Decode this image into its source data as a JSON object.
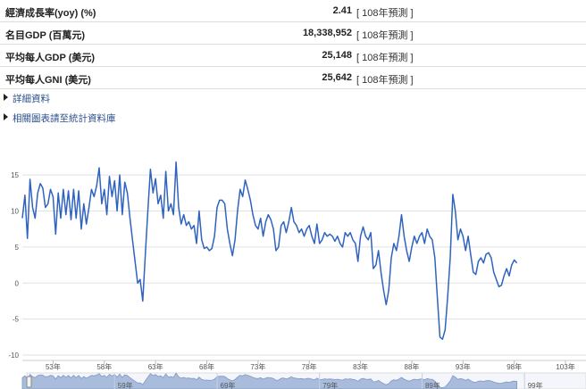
{
  "stats": [
    {
      "label": "經濟成長率(yoy) (%)",
      "value": "2.41",
      "note": "[ 108年預測 ]"
    },
    {
      "label": "名目GDP (百萬元)",
      "value": "18,338,952",
      "note": "[ 108年預測 ]"
    },
    {
      "label": "平均每人GDP (美元)",
      "value": "25,148",
      "note": "[ 108年預測 ]"
    },
    {
      "label": "平均每人GNI (美元)",
      "value": "25,642",
      "note": "[ 108年預測 ]"
    }
  ],
  "links": [
    {
      "label": "詳細資料"
    },
    {
      "label": "相關圖表請至統計資料庫"
    }
  ],
  "colors": {
    "line": "#2f63c0",
    "grid": "#e0e0e0",
    "navigator_fill": "#a9bcdc",
    "link": "#2b4f8c"
  },
  "chart_data": {
    "type": "line",
    "ylim": [
      -10,
      17
    ],
    "y_ticks": [
      -10,
      -5,
      0,
      5,
      10,
      15
    ],
    "x_ticks": [
      "53年",
      "58年",
      "63年",
      "68年",
      "73年",
      "78年",
      "83年",
      "88年",
      "93年",
      "98年",
      "103年"
    ],
    "x_tick_values": [
      53,
      58,
      63,
      68,
      73,
      78,
      83,
      88,
      93,
      98,
      103
    ],
    "navigator_ticks": [
      "59年",
      "69年",
      "79年",
      "89年",
      "99年"
    ],
    "navigator_tick_values": [
      59,
      69,
      79,
      89,
      99
    ],
    "grid": true,
    "series": [
      {
        "values": [
          [
            50.0,
            9.0
          ],
          [
            50.25,
            12.2
          ],
          [
            50.5,
            6.2
          ],
          [
            50.75,
            14.4
          ],
          [
            51.0,
            10.5
          ],
          [
            51.25,
            9.0
          ],
          [
            51.5,
            12.5
          ],
          [
            51.75,
            13.8
          ],
          [
            52.0,
            13.2
          ],
          [
            52.25,
            10.5
          ],
          [
            52.5,
            11.0
          ],
          [
            52.75,
            13.0
          ],
          [
            53.0,
            12.0
          ],
          [
            53.25,
            6.8
          ],
          [
            53.5,
            12.5
          ],
          [
            53.75,
            9.0
          ],
          [
            54.0,
            13.0
          ],
          [
            54.25,
            9.5
          ],
          [
            54.5,
            12.8
          ],
          [
            54.75,
            8.8
          ],
          [
            55.0,
            13.0
          ],
          [
            55.25,
            9.0
          ],
          [
            55.5,
            12.8
          ],
          [
            55.75,
            7.5
          ],
          [
            56.0,
            11.0
          ],
          [
            56.25,
            8.2
          ],
          [
            56.5,
            10.5
          ],
          [
            56.75,
            13.0
          ],
          [
            57.0,
            12.0
          ],
          [
            57.25,
            13.5
          ],
          [
            57.5,
            16.0
          ],
          [
            57.75,
            11.0
          ],
          [
            58.0,
            13.0
          ],
          [
            58.25,
            9.5
          ],
          [
            58.5,
            14.8
          ],
          [
            58.75,
            12.0
          ],
          [
            59.0,
            14.2
          ],
          [
            59.25,
            10.0
          ],
          [
            59.5,
            15.0
          ],
          [
            59.75,
            9.5
          ],
          [
            60.0,
            14.0
          ],
          [
            60.25,
            12.5
          ],
          [
            60.5,
            9.0
          ],
          [
            60.75,
            6.0
          ],
          [
            61.0,
            3.0
          ],
          [
            61.25,
            0.0
          ],
          [
            61.5,
            0.5
          ],
          [
            61.75,
            -2.5
          ],
          [
            62.0,
            4.0
          ],
          [
            62.25,
            10.0
          ],
          [
            62.5,
            15.8
          ],
          [
            62.75,
            12.5
          ],
          [
            63.0,
            14.5
          ],
          [
            63.25,
            11.0
          ],
          [
            63.5,
            12.2
          ],
          [
            63.75,
            9.0
          ],
          [
            64.0,
            15.5
          ],
          [
            64.25,
            10.0
          ],
          [
            64.5,
            11.0
          ],
          [
            64.75,
            9.5
          ],
          [
            65.0,
            16.8
          ],
          [
            65.25,
            10.5
          ],
          [
            65.5,
            8.2
          ],
          [
            65.75,
            9.5
          ],
          [
            66.0,
            8.0
          ],
          [
            66.25,
            8.5
          ],
          [
            66.5,
            7.5
          ],
          [
            66.75,
            8.0
          ],
          [
            67.0,
            5.5
          ],
          [
            67.25,
            10.0
          ],
          [
            67.5,
            6.0
          ],
          [
            67.75,
            4.8
          ],
          [
            68.0,
            5.0
          ],
          [
            68.25,
            4.5
          ],
          [
            68.5,
            4.8
          ],
          [
            68.75,
            6.5
          ],
          [
            69.0,
            10.5
          ],
          [
            69.25,
            11.5
          ],
          [
            69.5,
            11.5
          ],
          [
            69.75,
            11.0
          ],
          [
            70.0,
            7.5
          ],
          [
            70.25,
            5.5
          ],
          [
            70.5,
            3.8
          ],
          [
            70.75,
            6.0
          ],
          [
            71.0,
            10.0
          ],
          [
            71.25,
            13.0
          ],
          [
            71.5,
            12.0
          ],
          [
            71.75,
            14.3
          ],
          [
            72.0,
            13.0
          ],
          [
            72.25,
            11.5
          ],
          [
            72.5,
            9.5
          ],
          [
            72.75,
            8.0
          ],
          [
            73.0,
            7.5
          ],
          [
            73.25,
            9.0
          ],
          [
            73.5,
            6.5
          ],
          [
            73.75,
            8.5
          ],
          [
            74.0,
            9.5
          ],
          [
            74.25,
            8.8
          ],
          [
            74.5,
            7.5
          ],
          [
            74.75,
            4.5
          ],
          [
            75.0,
            5.0
          ],
          [
            75.25,
            8.0
          ],
          [
            75.5,
            8.5
          ],
          [
            75.75,
            7.0
          ],
          [
            76.0,
            8.5
          ],
          [
            76.25,
            10.5
          ],
          [
            76.5,
            8.5
          ],
          [
            76.75,
            8.0
          ],
          [
            77.0,
            7.0
          ],
          [
            77.25,
            7.5
          ],
          [
            77.5,
            6.5
          ],
          [
            77.75,
            7.5
          ],
          [
            78.0,
            8.0
          ],
          [
            78.25,
            6.5
          ],
          [
            78.5,
            5.5
          ],
          [
            78.75,
            8.2
          ],
          [
            79.0,
            5.5
          ],
          [
            79.25,
            6.0
          ],
          [
            79.5,
            7.0
          ],
          [
            79.75,
            6.5
          ],
          [
            80.0,
            6.8
          ],
          [
            80.25,
            6.5
          ],
          [
            80.5,
            5.8
          ],
          [
            80.75,
            6.5
          ],
          [
            81.0,
            5.5
          ],
          [
            81.25,
            5.0
          ],
          [
            81.5,
            7.0
          ],
          [
            81.75,
            6.5
          ],
          [
            82.0,
            7.0
          ],
          [
            82.25,
            6.0
          ],
          [
            82.5,
            5.5
          ],
          [
            82.75,
            3.0
          ],
          [
            83.0,
            6.5
          ],
          [
            83.25,
            7.8
          ],
          [
            83.5,
            6.5
          ],
          [
            83.75,
            6.0
          ],
          [
            84.0,
            7.0
          ],
          [
            84.25,
            2.0
          ],
          [
            84.5,
            2.5
          ],
          [
            84.75,
            4.5
          ],
          [
            85.0,
            1.5
          ],
          [
            85.25,
            -1.0
          ],
          [
            85.5,
            -3.0
          ],
          [
            85.75,
            -1.0
          ],
          [
            86.0,
            3.5
          ],
          [
            86.25,
            5.5
          ],
          [
            86.5,
            4.5
          ],
          [
            86.75,
            6.5
          ],
          [
            87.0,
            9.5
          ],
          [
            87.25,
            6.5
          ],
          [
            87.5,
            4.5
          ],
          [
            87.75,
            3.0
          ],
          [
            88.0,
            5.0
          ],
          [
            88.25,
            6.5
          ],
          [
            88.5,
            5.5
          ],
          [
            88.75,
            6.5
          ],
          [
            89.0,
            7.0
          ],
          [
            89.25,
            5.5
          ],
          [
            89.5,
            7.5
          ],
          [
            89.75,
            6.5
          ],
          [
            90.0,
            6.0
          ],
          [
            90.25,
            3.5
          ],
          [
            90.5,
            -2.0
          ],
          [
            90.75,
            -7.5
          ],
          [
            91.0,
            -7.8
          ],
          [
            91.25,
            -6.5
          ],
          [
            91.5,
            -2.0
          ],
          [
            91.75,
            3.5
          ],
          [
            92.0,
            12.3
          ],
          [
            92.25,
            10.0
          ],
          [
            92.5,
            6.0
          ],
          [
            92.75,
            7.5
          ],
          [
            93.0,
            6.5
          ],
          [
            93.25,
            4.5
          ],
          [
            93.5,
            6.5
          ],
          [
            93.75,
            4.0
          ],
          [
            94.0,
            1.5
          ],
          [
            94.25,
            1.2
          ],
          [
            94.5,
            3.0
          ],
          [
            94.75,
            3.5
          ],
          [
            95.0,
            2.8
          ],
          [
            95.25,
            4.0
          ],
          [
            95.5,
            4.2
          ],
          [
            95.75,
            3.5
          ],
          [
            96.0,
            1.5
          ],
          [
            96.25,
            0.5
          ],
          [
            96.5,
            -0.5
          ],
          [
            96.75,
            -0.3
          ],
          [
            97.0,
            1.0
          ],
          [
            97.25,
            2.0
          ],
          [
            97.5,
            1.0
          ],
          [
            97.75,
            2.5
          ],
          [
            98.0,
            3.2
          ],
          [
            98.25,
            2.8
          ]
        ]
      }
    ]
  }
}
